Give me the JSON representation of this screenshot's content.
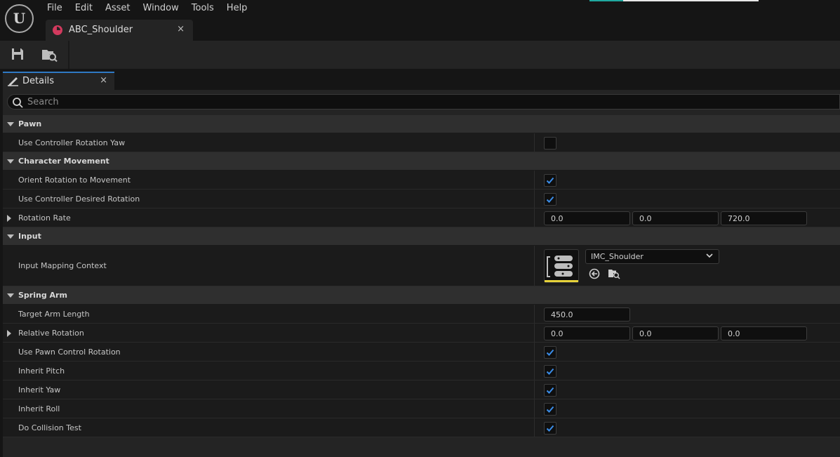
{
  "menu": [
    "File",
    "Edit",
    "Asset",
    "Window",
    "Tools",
    "Help"
  ],
  "document_tab": {
    "label": "ABC_Shoulder",
    "close": "×"
  },
  "details_tab": {
    "label": "Details",
    "close": "×"
  },
  "search": {
    "placeholder": "Search",
    "value": ""
  },
  "colors": {
    "accent": "#2f79c4",
    "asset_icon": "#d23a5e",
    "check": "#3b8eea",
    "thumb_underline": "#e6d23a"
  },
  "categories": {
    "pawn": {
      "label": "Pawn",
      "rows": {
        "use_controller_rotation_yaw": {
          "label": "Use Controller Rotation Yaw",
          "checked": false
        }
      }
    },
    "character_movement": {
      "label": "Character Movement",
      "rows": {
        "orient_rotation": {
          "label": "Orient Rotation to Movement",
          "checked": true
        },
        "use_controller_desired": {
          "label": "Use Controller Desired Rotation",
          "checked": true
        },
        "rotation_rate": {
          "label": "Rotation Rate",
          "x": "0.0",
          "y": "0.0",
          "z": "720.0"
        }
      }
    },
    "input": {
      "label": "Input",
      "rows": {
        "input_mapping_context": {
          "label": "Input Mapping Context",
          "value": "IMC_Shoulder"
        }
      }
    },
    "spring_arm": {
      "label": "Spring Arm",
      "rows": {
        "target_arm_length": {
          "label": "Target Arm Length",
          "value": "450.0"
        },
        "relative_rotation": {
          "label": "Relative Rotation",
          "x": "0.0",
          "y": "0.0",
          "z": "0.0"
        },
        "use_pawn_control_rotation": {
          "label": "Use Pawn Control Rotation",
          "checked": true
        },
        "inherit_pitch": {
          "label": "Inherit Pitch",
          "checked": true
        },
        "inherit_yaw": {
          "label": "Inherit Yaw",
          "checked": true
        },
        "inherit_roll": {
          "label": "Inherit Roll",
          "checked": true
        },
        "do_collision_test": {
          "label": "Do Collision Test",
          "checked": true
        }
      }
    }
  }
}
